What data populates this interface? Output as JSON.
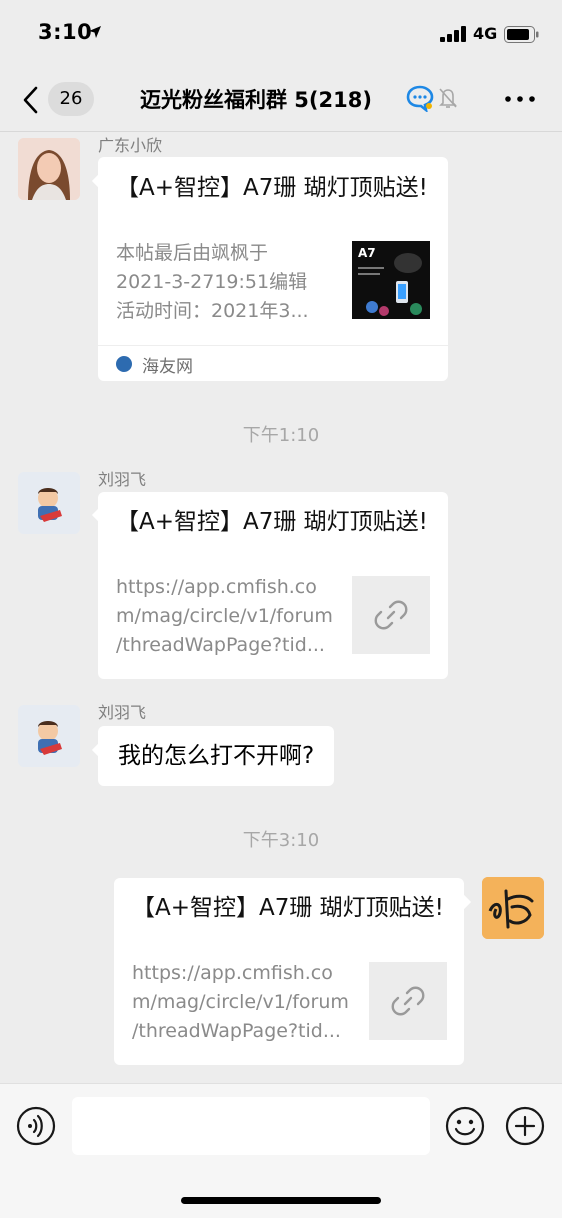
{
  "status_bar": {
    "time": "3:10",
    "network": "4G"
  },
  "nav": {
    "back_count": "26",
    "title": "迈光粉丝福利群 5(218)"
  },
  "messages": [
    {
      "sender": "广东小欣",
      "card": {
        "title": "【A+智控】A7珊 瑚灯顶贴送!",
        "desc_lines": [
          "本帖最后由飒枫于",
          "2021-3-2719:51编辑",
          "活动时间：2021年3..."
        ],
        "thumb_text": "A7",
        "source": "海友网"
      }
    },
    {
      "timestamp": "下午1:10"
    },
    {
      "sender": "刘羽飞",
      "card": {
        "title": "【A+智控】A7珊 瑚灯顶贴送!",
        "desc_lines": [
          "https://app.cmfish.co",
          "m/mag/circle/v1/forum",
          "/threadWapPage?tid..."
        ]
      }
    },
    {
      "sender": "刘羽飞",
      "text": "我的怎么打不开啊?"
    },
    {
      "timestamp": "下午3:10"
    },
    {
      "self": true,
      "card": {
        "title": "【A+智控】A7珊 瑚灯顶贴送!",
        "desc_lines": [
          "https://app.cmfish.co",
          "m/mag/circle/v1/forum",
          "/threadWapPage?tid..."
        ]
      }
    }
  ],
  "icons": [
    "location-arrow-icon",
    "signal-icon",
    "battery-icon",
    "chevron-left-icon",
    "chat-bubble-icon",
    "mute-bell-icon",
    "more-icon",
    "link-icon",
    "voice-icon",
    "emoji-icon",
    "plus-icon"
  ],
  "colors": {
    "background": "#ededed",
    "bubble": "#ffffff",
    "meta_text": "#a7a7a7"
  }
}
